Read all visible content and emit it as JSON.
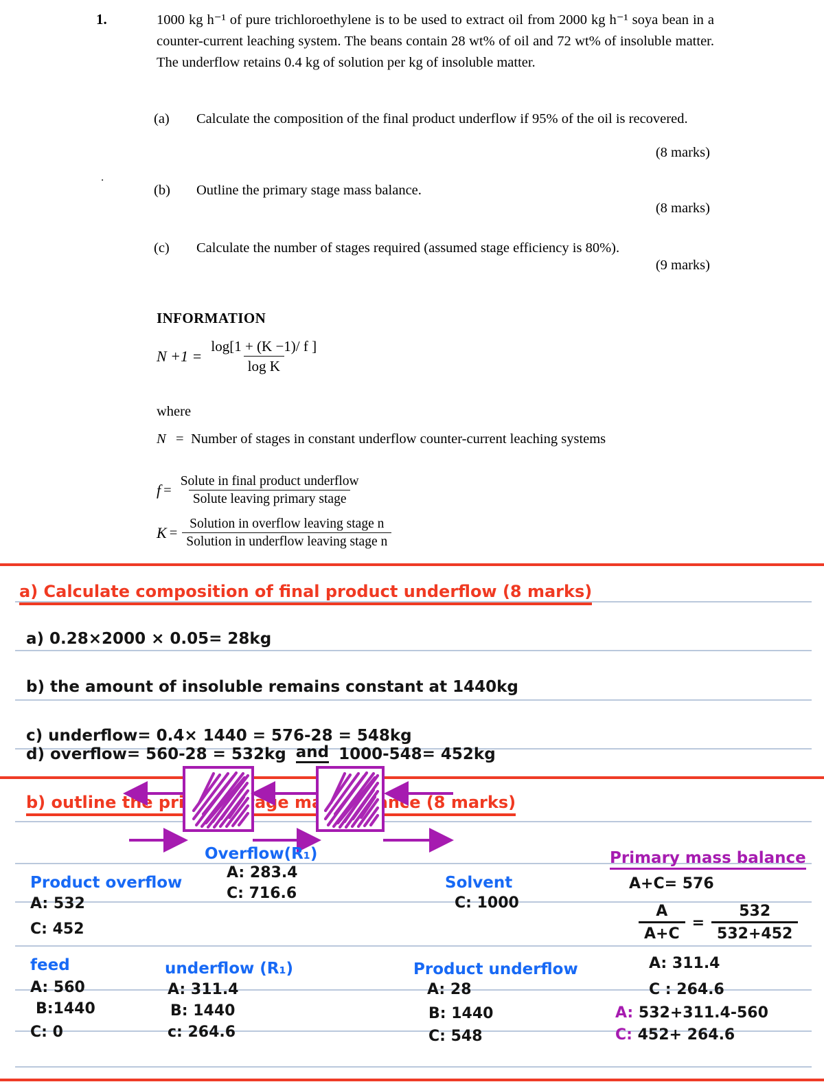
{
  "printed": {
    "question_number": "1.",
    "stem": "1000 kg h⁻¹ of pure trichloroethylene is to be used to extract oil from 2000 kg h⁻¹ soya bean in a counter-current leaching system. The beans contain 28 wt% of oil and 72 wt% of insoluble matter. The underflow retains 0.4 kg of solution per kg of insoluble matter.",
    "parts": [
      {
        "label": "(a)",
        "text": "Calculate the composition of the final product underflow if 95% of the oil is recovered.",
        "marks": "(8 marks)"
      },
      {
        "label": "(b)",
        "text": "Outline the primary stage mass balance.",
        "marks": "(8 marks)"
      },
      {
        "label": "(c)",
        "text": "Calculate the number of stages required (assumed stage efficiency is 80%).",
        "marks": "(9 marks)"
      }
    ],
    "information": {
      "heading": "INFORMATION",
      "formula_lhs": "N +1 =",
      "formula_numerator": "log[1 + (K −1)/ f ]",
      "formula_denominator": "log K",
      "where": "where",
      "def_N_symbol": "N",
      "def_N_eq": "=",
      "def_N_text": "Number of stages in constant underflow counter-current leaching systems",
      "def_f_symbol": "f",
      "def_f_eq": "=",
      "def_f_numerator": "Solute in final product underflow",
      "def_f_denominator": "Solute leaving primary stage",
      "def_K_symbol": "K",
      "def_K_eq": "=",
      "def_K_numerator": "Solution in overflow leaving stage n",
      "def_K_denominator": "Solution in underflow leaving stage n"
    }
  },
  "notes": {
    "section_a": {
      "heading": "a) Calculate composition of final product underflow (8 marks)",
      "lines": [
        "a)  0.28×2000 × 0.05= 28kg",
        "b)  the amount of insoluble remains constant at 1440kg",
        "c)  underflow=  0.4× 1440 = 576-28 = 548kg"
      ],
      "line_d_pre": "d)  overflow= 560-28 = 532kg",
      "line_d_and": "and",
      "line_d_post": "1000-548= 452kg"
    },
    "section_b": {
      "heading": "b) outline the primary stage mass balance (8 marks)",
      "overflow": {
        "title": "Overflow(R₁)",
        "rows": [
          "A: 283.4",
          "C: 716.6"
        ]
      },
      "product_overflow": {
        "title": "Product overflow",
        "rows": [
          "A: 532",
          "C: 452"
        ]
      },
      "solvent": {
        "title": "Solvent",
        "rows": [
          "C: 1000"
        ]
      },
      "feed": {
        "title": "feed",
        "rows": [
          "A: 560",
          "B:1440",
          "C: 0"
        ]
      },
      "underflow": {
        "title": "underflow (R₁)",
        "rows": [
          "A: 311.4",
          "B: 1440",
          "c: 264.6"
        ]
      },
      "product_underflow": {
        "title": "Product underflow",
        "rows": [
          "A: 28",
          "B: 1440",
          "C: 548"
        ]
      },
      "balance": {
        "heading": "Primary mass balance",
        "eq1": "A+C= 576",
        "frac_left_num": "A",
        "frac_left_den": "A+C",
        "frac_eq": "=",
        "frac_right_num": "532",
        "frac_right_den": "532+452",
        "result1": "A: 311.4",
        "result2": "C : 264.6",
        "sum_a_label": "A:",
        "sum_a_value": "532+311.4-560",
        "sum_c_label": "C:",
        "sum_c_value": "452+ 264.6"
      }
    },
    "colors": {
      "red": "#f03a22",
      "blue": "#1769f5",
      "purple": "#a61bb0",
      "rule": "#aebed6"
    }
  }
}
